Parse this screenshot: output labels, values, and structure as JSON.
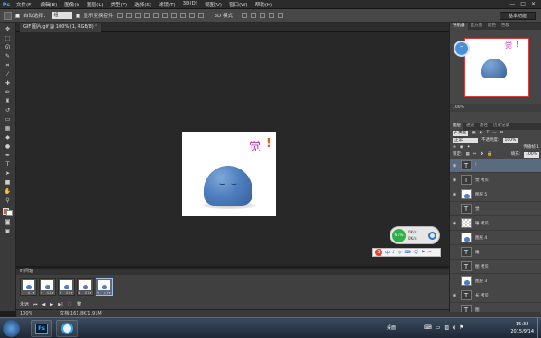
{
  "app": {
    "logo": "Ps"
  },
  "menu": [
    "文件(F)",
    "编辑(E)",
    "图像(I)",
    "图层(L)",
    "类型(Y)",
    "选择(S)",
    "滤镜(T)",
    "3D(D)",
    "视图(V)",
    "窗口(W)",
    "帮助(H)"
  ],
  "window_controls": [
    "—",
    "□",
    "✕"
  ],
  "options": {
    "auto_select_label": "自动选择：",
    "auto_select_value": "组",
    "show_transform_label": "显示变换控件",
    "mode_3d_label": "3D 模式：",
    "workspace": "基本功能"
  },
  "document": {
    "tab_title": "GIF 图片.gif @ 100% (1, RGB/8) *"
  },
  "canvas": {
    "char": "觉",
    "excl": "!"
  },
  "widget": {
    "percent": "67%",
    "row1": "0K/s",
    "row2": "0K/s"
  },
  "ime": {
    "logo": "S",
    "items": [
      "中",
      "♪",
      "◎",
      "⌨",
      "☺",
      "⚑",
      "✂"
    ]
  },
  "timeline": {
    "title": "时间轴",
    "frames": [
      {
        "num": "1",
        "time": "0.1▾"
      },
      {
        "num": "2",
        "time": "0.1▾"
      },
      {
        "num": "3",
        "time": "0.1▾"
      },
      {
        "num": "4",
        "time": "0.1▾"
      },
      {
        "num": "5",
        "time": "0.1▾"
      }
    ],
    "loop": "永远",
    "controls": [
      "⏮",
      "◀",
      "▶",
      "▶|",
      "⬚",
      "🗑"
    ]
  },
  "status": {
    "zoom": "100%",
    "doc": "文档:161.8K/1.91M"
  },
  "panels": {
    "nav_tabs": [
      "导航器",
      "直方图",
      "颜色",
      "色板"
    ],
    "nav_zoom": "100%",
    "layer_tabs": [
      "图层",
      "通道",
      "路径",
      "历史记录"
    ],
    "filter_label": "ρ 类型",
    "blend_mode": "正常",
    "opacity_label": "不透明度:",
    "opacity_value": "100%",
    "lock_label": "锁定:",
    "fill_label": "填充:",
    "fill_value": "100%",
    "propagate_label": "传播帧 1",
    "layers": [
      {
        "name": "!",
        "type": "text",
        "visible": true,
        "selected": true
      },
      {
        "name": "觉 拷贝",
        "type": "text",
        "visible": true
      },
      {
        "name": "图层 5",
        "type": "image",
        "visible": true
      },
      {
        "name": "觉",
        "type": "text",
        "visible": false
      },
      {
        "name": "睡 拷贝",
        "type": "image",
        "visible": true
      },
      {
        "name": "图层 4",
        "type": "image",
        "visible": false
      },
      {
        "name": "睡",
        "type": "text",
        "visible": false
      },
      {
        "name": "图 拷贝",
        "type": "text",
        "visible": false
      },
      {
        "name": "图层 3",
        "type": "image",
        "visible": false
      },
      {
        "name": "长 拷贝",
        "type": "text",
        "visible": true
      },
      {
        "name": "图",
        "type": "text",
        "visible": false
      },
      {
        "name": "图层 2",
        "type": "image",
        "visible": false
      }
    ]
  },
  "taskbar": {
    "desktop_label": "桌面",
    "time": "15:32",
    "date": "2015/9/14"
  }
}
